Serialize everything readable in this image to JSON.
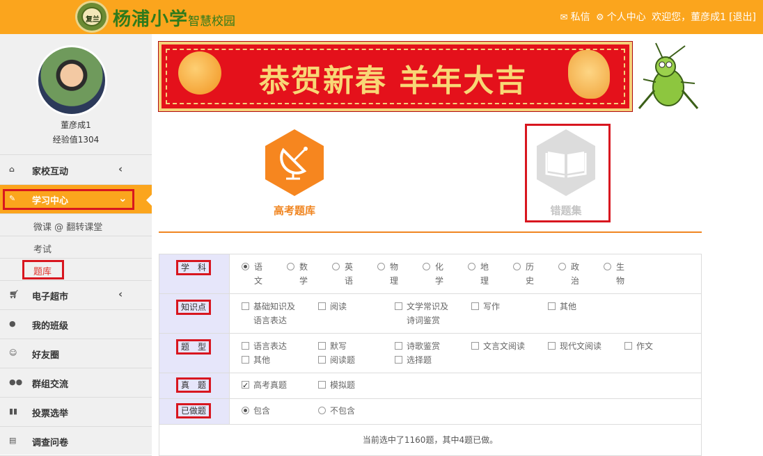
{
  "header": {
    "logo_seal_text": "复兰",
    "logo_title": "杨浦小学",
    "logo_subtitle": "智慧校园",
    "messages": "私信",
    "personal_center": "个人中心",
    "welcome": "欢迎您，董彦成1",
    "logout": "[退出]"
  },
  "profile": {
    "name": "董彦成1",
    "exp": "经验值1304"
  },
  "nav": {
    "items": [
      {
        "label": "家校互动",
        "icon": "home-icon"
      },
      {
        "label": "学习中心",
        "icon": "edit-icon"
      },
      {
        "label": "电子超市",
        "icon": "cart-icon"
      },
      {
        "label": "我的班级",
        "icon": "user-icon"
      },
      {
        "label": "好友圈",
        "icon": "smile-icon"
      },
      {
        "label": "群组交流",
        "icon": "group-icon"
      },
      {
        "label": "投票选举",
        "icon": "bar-chart-icon"
      },
      {
        "label": "调查问卷",
        "icon": "file-icon"
      }
    ],
    "sub": [
      "微课 @ 翻转课堂",
      "考试",
      "题库"
    ]
  },
  "banner": {
    "text": "恭贺新春 羊年大吉"
  },
  "tiles": {
    "gaokao": "高考题库",
    "cuoti": "错题集"
  },
  "filters": {
    "subject": {
      "label": "学　科",
      "options": [
        "语文",
        "数学",
        "英语",
        "物理",
        "化学",
        "地理",
        "历史",
        "政治",
        "生物"
      ]
    },
    "knowledge": {
      "label": "知识点",
      "options": [
        "基础知识及语言表达",
        "阅读",
        "文学常识及诗词鉴赏",
        "写作",
        "其他"
      ]
    },
    "type": {
      "label": "题　型",
      "options": [
        "语言表达",
        "默写",
        "诗歌鉴赏",
        "文言文阅读",
        "现代文阅读",
        "作文",
        "其他",
        "阅读题",
        "选择题"
      ]
    },
    "real": {
      "label": "真　题",
      "options": [
        "高考真题",
        "模拟题"
      ]
    },
    "done": {
      "label": "已做题",
      "options": [
        "包含",
        "不包含"
      ]
    }
  },
  "summary": "当前选中了1160题，其中4题已做。"
}
